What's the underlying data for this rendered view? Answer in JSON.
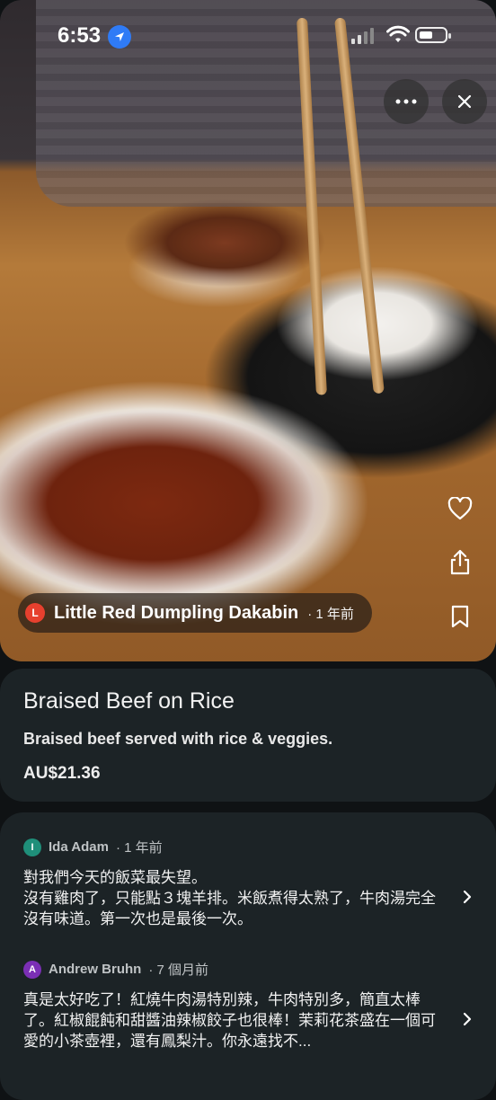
{
  "status_bar": {
    "time": "6:53"
  },
  "photo": {
    "alt": "Braised beef stew with potatoes and rice"
  },
  "actions": {
    "more_icon": "more-horizontal-icon",
    "close_icon": "close-icon",
    "like_icon": "heart-outline-icon",
    "share_icon": "share-icon",
    "bookmark_icon": "bookmark-outline-icon"
  },
  "restaurant": {
    "initial": "L",
    "name": "Little Red Dumpling Dakabin",
    "time": "· 1 年前",
    "avatar_color": "#e6402e"
  },
  "dish": {
    "title": "Braised Beef on Rice",
    "description": "Braised beef served with rice & veggies.",
    "price": "AU$21.36"
  },
  "reviews": [
    {
      "initial": "I",
      "name": "Ida Adam",
      "time": "· 1 年前",
      "avatar_color": "#1f8f7a",
      "text": "對我們今天的飯菜最失望。\n沒有雞肉了，只能點３塊羊排。米飯煮得太熟了，牛肉湯完全沒有味道。第一次也是最後一次。"
    },
    {
      "initial": "A",
      "name": "Andrew Bruhn",
      "time": "· 7 個月前",
      "avatar_color": "#7b2fb5",
      "text": "真是太好吃了！紅燒牛肉湯特別辣，牛肉特別多，簡直太棒了。紅椒餛飩和甜醬油辣椒餃子也很棒！茉莉花茶盛在一個可愛的小茶壺裡，還有鳳梨汁。你永遠找不..."
    }
  ]
}
